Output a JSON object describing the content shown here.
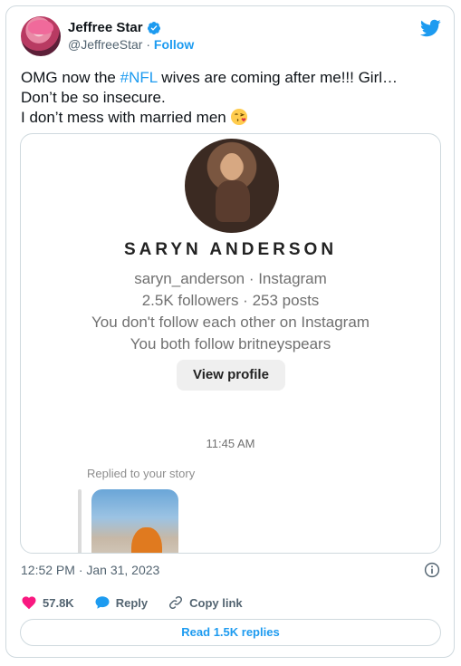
{
  "author": {
    "name": "Jeffree Star",
    "handle": "@JeffreeStar",
    "separator": " · ",
    "follow_label": "Follow"
  },
  "tweet": {
    "line1_pre": "OMG now the ",
    "hashtag": "#NFL",
    "line1_post": " wives are coming after me!!! Girl…",
    "line2": "Don’t be so insecure.",
    "line3": "I don’t mess with married men ",
    "emoji": "face-blowing-kiss-emoji"
  },
  "embedded": {
    "ig_name": "SARYN ANDERSON",
    "ig_handle_line": "saryn_anderson · Instagram",
    "stats_line": "2.5K followers · 253 posts",
    "follow_status": "You don't follow each other on Instagram",
    "mutual": "You both follow britneyspears",
    "view_profile_label": "View profile",
    "message_time": "11:45 AM",
    "replied_label": "Replied to your story"
  },
  "meta": {
    "timestamp": "12:52 PM · Jan 31, 2023"
  },
  "actions": {
    "likes": "57.8K",
    "reply_label": "Reply",
    "copy_link_label": "Copy link"
  },
  "read_replies_label": "Read 1.5K replies",
  "colors": {
    "accent": "#1d9bf0",
    "like": "#f91880",
    "muted": "#536471"
  }
}
